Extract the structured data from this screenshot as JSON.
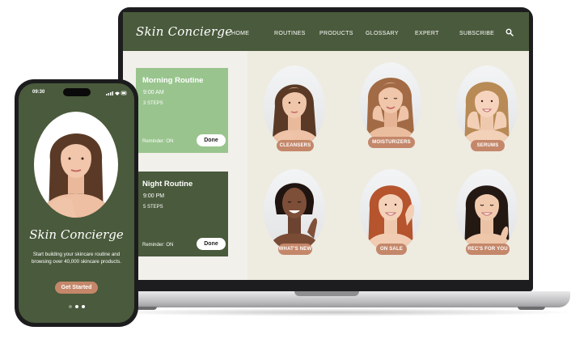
{
  "laptop": {
    "brand": "Skin Concierge",
    "nav": [
      {
        "label": "HOME"
      },
      {
        "label": "ROUTINES"
      },
      {
        "label": "PRODUCTS"
      },
      {
        "label": "GLOSSARY"
      },
      {
        "label": "EXPERT"
      },
      {
        "label": "SUBSCRIBE"
      }
    ],
    "search_icon": "search-icon",
    "routines": [
      {
        "title": "Morning Routine",
        "time": "9:00 AM",
        "steps": "3 STEPS",
        "reminder": "Reminder: ON",
        "done_label": "Done"
      },
      {
        "title": "Night Routine",
        "time": "9:00 PM",
        "steps": "5 STEPS",
        "reminder": "Reminder: ON",
        "done_label": "Done"
      }
    ],
    "categories": [
      {
        "label": "CLEANSERS"
      },
      {
        "label": "MOISTURIZERS"
      },
      {
        "label": "SERUMS"
      },
      {
        "label": "WHAT'S NEW"
      },
      {
        "label": "ON SALE"
      },
      {
        "label": "REC'S FOR YOU"
      }
    ]
  },
  "phone": {
    "status_time": "09:30",
    "brand": "Skin Concierge",
    "tagline": "Start building your skincare routine and browsing over 40,000 skincare products.",
    "cta_label": "Get Started",
    "page_indicator": {
      "current": 2,
      "total": 3
    }
  },
  "colors": {
    "brand_green": "#4a5a3c",
    "light_green": "#99c48e",
    "accent_terracotta": "#c4876a",
    "canvas_beige": "#eeebe1"
  }
}
